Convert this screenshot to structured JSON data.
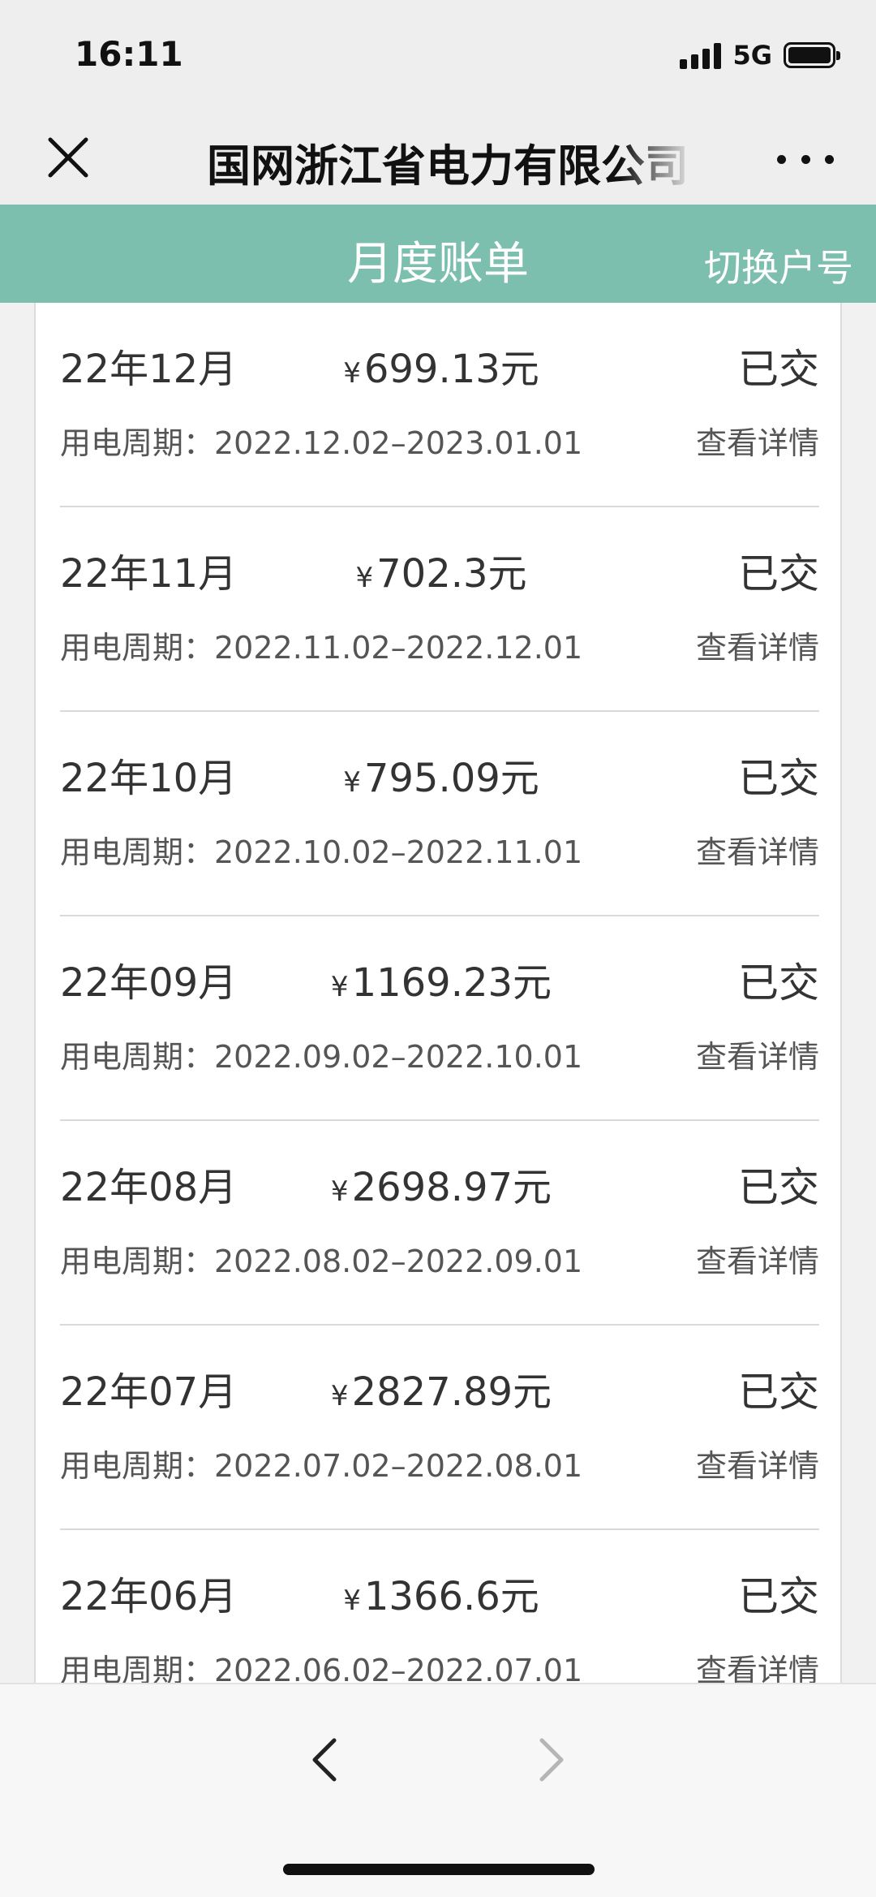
{
  "status_bar": {
    "time": "16:11",
    "network": "5G"
  },
  "nav": {
    "title": "国网浙江省电力有限公司"
  },
  "header": {
    "title": "月度账单",
    "switch_account": "切换户号"
  },
  "bills": [
    {
      "month": "22年12月",
      "amount": "699.13元",
      "status": "已交",
      "period": "用电周期：2022.12.02–2023.01.01",
      "detail": "查看详情"
    },
    {
      "month": "22年11月",
      "amount": "702.3元",
      "status": "已交",
      "period": "用电周期：2022.11.02–2022.12.01",
      "detail": "查看详情"
    },
    {
      "month": "22年10月",
      "amount": "795.09元",
      "status": "已交",
      "period": "用电周期：2022.10.02–2022.11.01",
      "detail": "查看详情"
    },
    {
      "month": "22年09月",
      "amount": "1169.23元",
      "status": "已交",
      "period": "用电周期：2022.09.02–2022.10.01",
      "detail": "查看详情"
    },
    {
      "month": "22年08月",
      "amount": "2698.97元",
      "status": "已交",
      "period": "用电周期：2022.08.02–2022.09.01",
      "detail": "查看详情"
    },
    {
      "month": "22年07月",
      "amount": "2827.89元",
      "status": "已交",
      "period": "用电周期：2022.07.02–2022.08.01",
      "detail": "查看详情"
    },
    {
      "month": "22年06月",
      "amount": "1366.6元",
      "status": "已交",
      "period": "用电周期：2022.06.02–2022.07.01",
      "detail": "查看详情"
    }
  ],
  "currency_symbol": "¥",
  "colors": {
    "header_bg": "#7dbfae",
    "header_text": "#ffffff"
  },
  "icons": {
    "close": "close-icon",
    "more": "more-icon",
    "back": "chevron-left-icon",
    "forward": "chevron-right-icon"
  }
}
